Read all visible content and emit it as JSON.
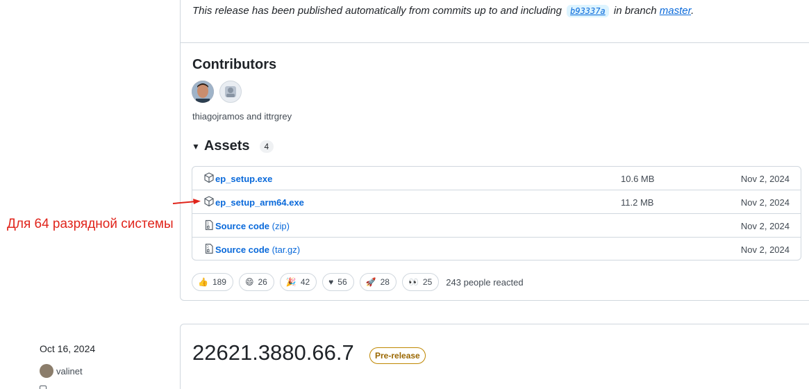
{
  "release1": {
    "published_prefix": "This release has been published automatically from commits up to and including",
    "commit": "b93337a",
    "branch_prefix": "in branch",
    "branch": "master",
    "branch_suffix": ".",
    "contributors_title": "Contributors",
    "contributors_text": "thiagojramos and ittrgrey",
    "assets_title": "Assets",
    "assets_count": "4",
    "assets": [
      {
        "name": "ep_setup.exe",
        "ext": "",
        "size": "10.6 MB",
        "date": "Nov 2, 2024",
        "icon": "package-icon"
      },
      {
        "name": "ep_setup_arm64.exe",
        "ext": "",
        "size": "11.2 MB",
        "date": "Nov 2, 2024",
        "icon": "package-icon"
      },
      {
        "name": "Source code",
        "ext": "(zip)",
        "size": "",
        "date": "Nov 2, 2024",
        "icon": "file-zip-icon"
      },
      {
        "name": "Source code",
        "ext": "(tar.gz)",
        "size": "",
        "date": "Nov 2, 2024",
        "icon": "file-zip-icon"
      }
    ],
    "reactions": [
      {
        "emoji": "👍",
        "count": "189",
        "icon": "thumbs-up-icon"
      },
      {
        "emoji": "😄",
        "count": "26",
        "icon": "smile-icon"
      },
      {
        "emoji": "🎉",
        "count": "42",
        "icon": "tada-icon"
      },
      {
        "emoji": "♥",
        "count": "56",
        "icon": "heart-icon"
      },
      {
        "emoji": "🚀",
        "count": "28",
        "icon": "rocket-icon"
      },
      {
        "emoji": "👀",
        "count": "25",
        "icon": "eyes-icon"
      }
    ],
    "reacted_text": "243 people reacted"
  },
  "annotation": {
    "text": "Для 64 разрядной системы",
    "color": "#e0241b"
  },
  "release2": {
    "date": "Oct 16, 2024",
    "author": "valinet",
    "title": "22621.3880.66.7",
    "badge": "Pre-release"
  },
  "colors": {
    "link": "#0969da",
    "border": "#d0d7de",
    "prerelease": "#9a6700"
  }
}
